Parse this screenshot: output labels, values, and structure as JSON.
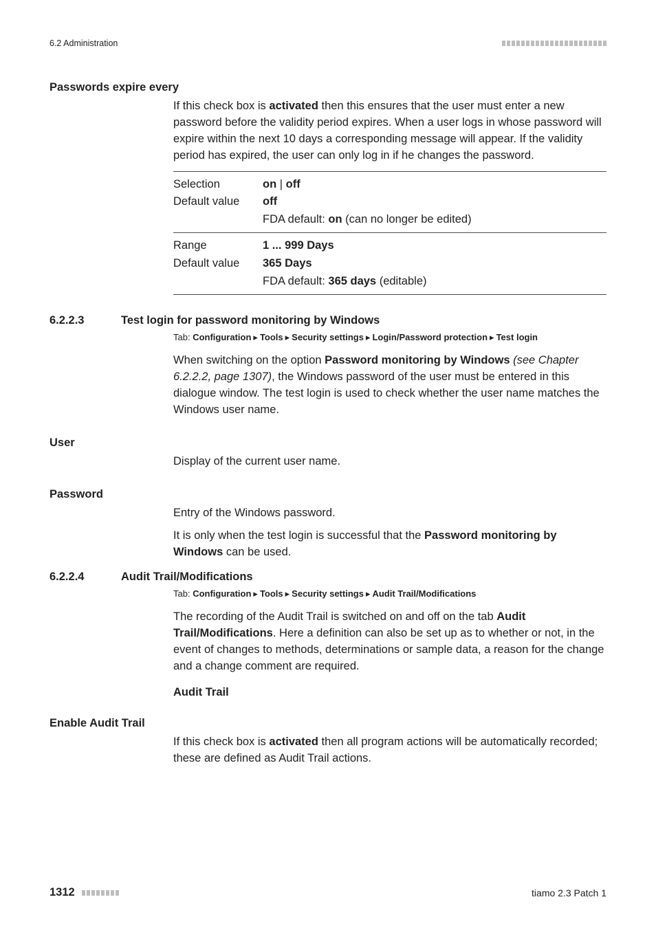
{
  "runhead": {
    "left": "6.2 Administration"
  },
  "s1": {
    "heading": "Passwords expire every",
    "para_parts": {
      "p1": "If this check box is ",
      "p2": "activated",
      "p3": " then this ensures that the user must enter a new password before the validity period expires. When a user logs in whose password will expire within the next 10 days a corresponding message will appear. If the validity period has expired, the user can only log in if he changes the password."
    },
    "kv1": {
      "selection_k": "Selection",
      "selection_v_on": "on",
      "selection_sep": " | ",
      "selection_v_off": "off",
      "default_k": "Default value",
      "default_v": "off",
      "fda_prefix": "FDA default: ",
      "fda_v": "on",
      "fda_suffix": " (can no longer be edited)"
    },
    "kv2": {
      "range_k": "Range",
      "range_v": "1 ... 999 Days",
      "default_k": "Default value",
      "default_v": "365 Days",
      "fda_prefix": "FDA default: ",
      "fda_v": "365 days",
      "fda_suffix": " (editable)"
    }
  },
  "s2": {
    "num": "6.2.2.3",
    "heading": "Test login for password monitoring by Windows",
    "tab": {
      "prefix": "Tab: ",
      "t1": "Configuration",
      "t2": "Tools",
      "t3": "Security settings",
      "t4": "Login/Password protection",
      "t5": "Test login"
    },
    "para": {
      "p1": "When switching on the option ",
      "p2": "Password monitoring by Windows",
      "p3_italic": " (see Chapter 6.2.2.2, page 1307)",
      "p4": ", the Windows password of the user must be entered in this dialogue window. The test login is used to check whether the user name matches the Windows user name."
    },
    "user_heading": "User",
    "user_para": "Display of the current user name.",
    "pwd_heading": "Password",
    "pwd_para1": "Entry of the Windows password.",
    "pwd_para2": {
      "p1": "It is only when the test login is successful that the ",
      "p2": "Password monitoring by Windows",
      "p3": " can be used."
    }
  },
  "s3": {
    "num": "6.2.2.4",
    "heading": "Audit Trail/Modifications",
    "tab": {
      "prefix": "Tab: ",
      "t1": "Configuration",
      "t2": "Tools",
      "t3": "Security settings",
      "t4": "Audit Trail/Modifications"
    },
    "para": {
      "p1": "The recording of the Audit Trail is switched on and off on the tab ",
      "p2": "Audit Trail/Modifications",
      "p3": ". Here a definition can also be set up as to whether or not, in the event of changes to methods, determinations or sample data, a reason for the change and a change comment are required."
    },
    "sub": "Audit Trail",
    "enable_heading": "Enable Audit Trail",
    "enable_para": {
      "p1": "If this check box is ",
      "p2": "activated",
      "p3": " then all program actions will be automatically recorded; these are defined as Audit Trail actions."
    }
  },
  "footer": {
    "page": "1312",
    "right": "tiamo 2.3 Patch 1"
  }
}
